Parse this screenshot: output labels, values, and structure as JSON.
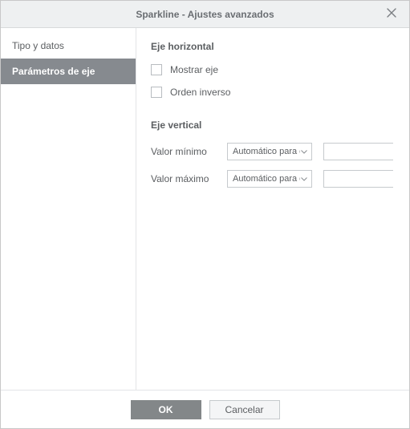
{
  "title": "Sparkline - Ajustes avanzados",
  "tabs": {
    "type_data": "Tipo y datos",
    "axis_params": "Parámetros de eje"
  },
  "panel": {
    "horizontal": {
      "title": "Eje horizontal",
      "show_axis": "Mostrar eje",
      "reverse_order": "Orden inverso"
    },
    "vertical": {
      "title": "Eje vertical",
      "min_label": "Valor mínimo",
      "max_label": "Valor máximo",
      "min_option": "Automático para cada",
      "max_option": "Automático para cada",
      "min_value": "",
      "max_value": ""
    }
  },
  "footer": {
    "ok": "OK",
    "cancel": "Cancelar"
  }
}
